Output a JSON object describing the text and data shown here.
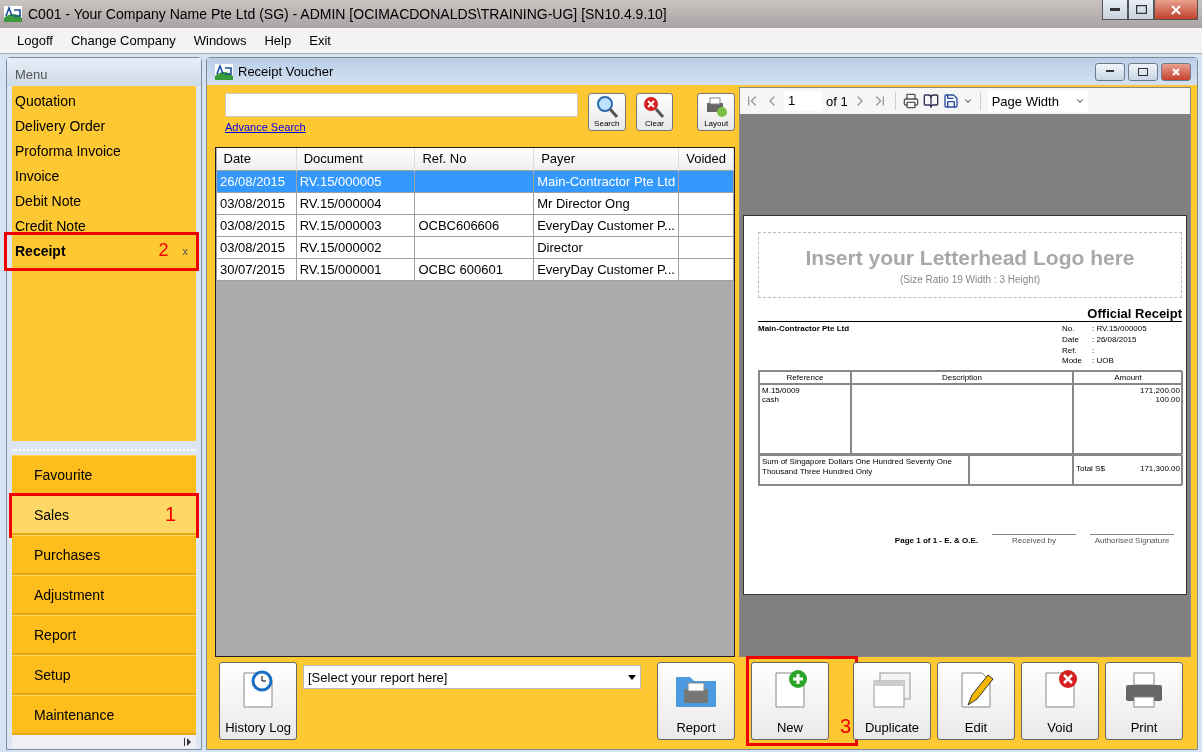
{
  "window": {
    "title": "C001 - Your Company Name Pte Ltd (SG) - ADMIN [OCIMACDONALDS\\TRAINING-UG] [SN10.4.9.10]"
  },
  "menubar": [
    "Logoff",
    "Change Company",
    "Windows",
    "Help",
    "Exit"
  ],
  "sidebar": {
    "title": "Menu",
    "items": [
      {
        "label": "Quotation",
        "selected": false
      },
      {
        "label": "Delivery Order",
        "selected": false
      },
      {
        "label": "Proforma Invoice",
        "selected": false
      },
      {
        "label": "Invoice",
        "selected": false
      },
      {
        "label": "Debit Note",
        "selected": false
      },
      {
        "label": "Credit Note",
        "selected": false
      },
      {
        "label": "Receipt",
        "selected": true,
        "close": "x",
        "callout": "2"
      }
    ],
    "groups": [
      {
        "label": "Favourite",
        "selected": false
      },
      {
        "label": "Sales",
        "selected": true,
        "callout": "1"
      },
      {
        "label": "Purchases",
        "selected": false
      },
      {
        "label": "Adjustment",
        "selected": false
      },
      {
        "label": "Report",
        "selected": false
      },
      {
        "label": "Setup",
        "selected": false
      },
      {
        "label": "Maintenance",
        "selected": false
      }
    ]
  },
  "voucher": {
    "title": "Receipt Voucher",
    "advance_search": "Advance Search",
    "tools": [
      {
        "kind": "search",
        "label": "Search"
      },
      {
        "kind": "clear",
        "label": "Clear"
      },
      {
        "kind": "layout",
        "label": "Layout"
      }
    ],
    "table": {
      "columns": [
        "Date",
        "Document",
        "Ref. No",
        "Payer",
        "Voided"
      ],
      "rows": [
        {
          "cells": [
            "26/08/2015",
            "RV.15/000005",
            "",
            "Main-Contractor Pte Ltd",
            ""
          ],
          "selected": true
        },
        {
          "cells": [
            "03/08/2015",
            "RV.15/000004",
            "",
            "Mr Director Ong",
            ""
          ],
          "selected": false
        },
        {
          "cells": [
            "03/08/2015",
            "RV.15/000003",
            "OCBC606606",
            "EveryDay Customer P...",
            ""
          ],
          "selected": false
        },
        {
          "cells": [
            "03/08/2015",
            "RV.15/000002",
            "",
            "Director",
            ""
          ],
          "selected": false
        },
        {
          "cells": [
            "30/07/2015",
            "RV.15/000001",
            "OCBC 600601",
            "EveryDay Customer P...",
            ""
          ],
          "selected": false
        }
      ]
    }
  },
  "viewer": {
    "page": "1",
    "of": "of 1",
    "zoom": "Page Width",
    "document": {
      "logo_text": "Insert your Letterhead Logo here",
      "logo_hint": "(Size Ratio 19 Width : 3 Height)",
      "title": "Official Receipt",
      "payer": "Main-Contractor Pte Ltd",
      "meta": [
        {
          "label": "No.",
          "value": ": RV.15/000005"
        },
        {
          "label": "Date",
          "value": ": 26/08/2015"
        },
        {
          "label": "Ref.",
          "value": ":"
        },
        {
          "label": "Mode",
          "value": ": UOB"
        }
      ],
      "columns": [
        "Reference",
        "Description",
        "Amount"
      ],
      "references": [
        "M.15/0009",
        "cash"
      ],
      "amounts": [
        "171,200.00",
        "100.00"
      ],
      "amount_words": "Sum of Singapore Dollars One Hundred Seventy One Thousand Three Hundred Only",
      "total_label": "Total S$",
      "total": "171,300.00",
      "page_note": "Page 1 of 1 - E. & O.E.",
      "signatures": [
        "Received by",
        "Authorised Signature"
      ]
    }
  },
  "footer": {
    "report_select": "[Select your report here]",
    "buttons": [
      {
        "kind": "history",
        "label": "History Log"
      },
      {
        "kind": "report",
        "label": "Report"
      },
      {
        "kind": "new",
        "label": "New",
        "callout": "3"
      },
      {
        "kind": "duplicate",
        "label": "Duplicate"
      },
      {
        "kind": "edit",
        "label": "Edit"
      },
      {
        "kind": "void",
        "label": "Void"
      },
      {
        "kind": "print",
        "label": "Print"
      }
    ]
  }
}
